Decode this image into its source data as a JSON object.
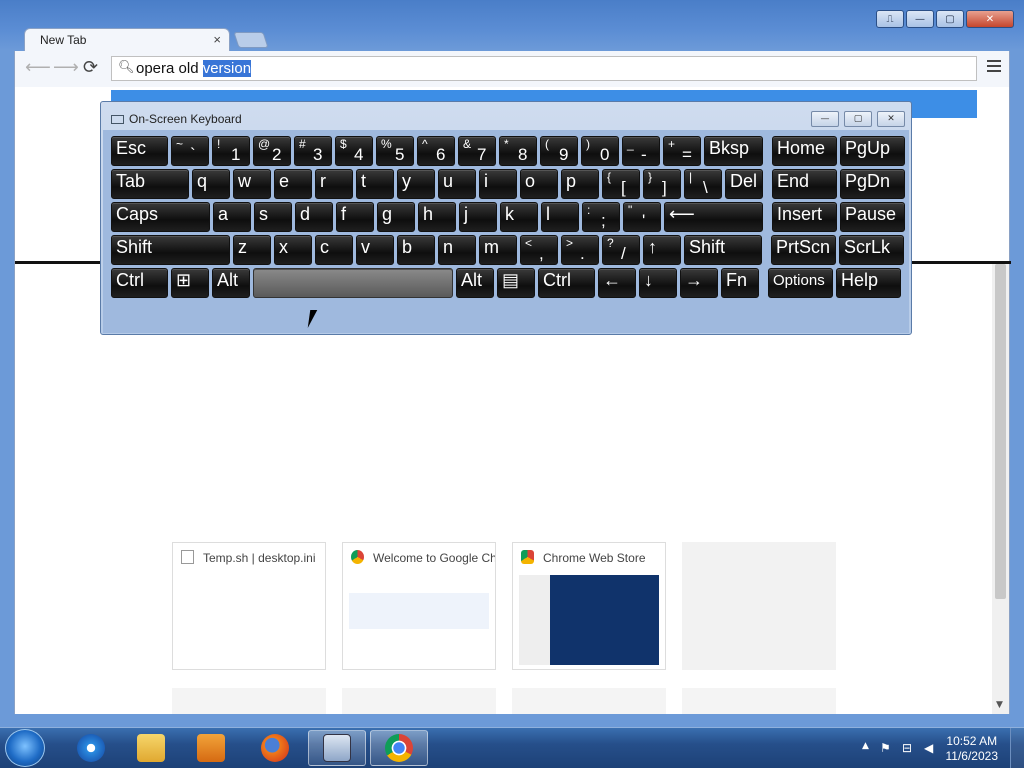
{
  "browser": {
    "tab_title": "New Tab",
    "tab_close": "×",
    "address_text": "opera old ",
    "address_selected": "version",
    "window_buttons": [
      "⎍",
      "—",
      "▢",
      "✕"
    ]
  },
  "thumbnails": [
    {
      "title": "Temp.sh | desktop.ini",
      "icon": "page-icon"
    },
    {
      "title": "Welcome to Google Chrome",
      "icon": "chrome-icon"
    },
    {
      "title": "Chrome Web Store",
      "icon": "webstore-icon"
    },
    {
      "title": "",
      "icon": ""
    }
  ],
  "osk": {
    "title": "On-Screen Keyboard",
    "row1": [
      {
        "label": "Esc"
      },
      {
        "shift": "~",
        "main": "`"
      },
      {
        "shift": "!",
        "main": "1"
      },
      {
        "shift": "@",
        "main": "2"
      },
      {
        "shift": "#",
        "main": "3"
      },
      {
        "shift": "$",
        "main": "4"
      },
      {
        "shift": "%",
        "main": "5"
      },
      {
        "shift": "^",
        "main": "6"
      },
      {
        "shift": "&",
        "main": "7"
      },
      {
        "shift": "*",
        "main": "8"
      },
      {
        "shift": "(",
        "main": "9"
      },
      {
        "shift": ")",
        "main": "0"
      },
      {
        "shift": "_",
        "main": "-"
      },
      {
        "shift": "+",
        "main": "="
      },
      {
        "label": "Bksp"
      },
      {
        "label": "Home"
      },
      {
        "label": "PgUp"
      }
    ],
    "row2": [
      {
        "label": "Tab"
      },
      {
        "label": "q"
      },
      {
        "label": "w"
      },
      {
        "label": "e"
      },
      {
        "label": "r"
      },
      {
        "label": "t"
      },
      {
        "label": "y"
      },
      {
        "label": "u"
      },
      {
        "label": "i"
      },
      {
        "label": "o"
      },
      {
        "label": "p"
      },
      {
        "shift": "{",
        "main": "["
      },
      {
        "shift": "}",
        "main": "]"
      },
      {
        "shift": "|",
        "main": "\\"
      },
      {
        "label": "Del"
      },
      {
        "label": "End"
      },
      {
        "label": "PgDn"
      }
    ],
    "row3": [
      {
        "label": "Caps"
      },
      {
        "label": "a"
      },
      {
        "label": "s"
      },
      {
        "label": "d"
      },
      {
        "label": "f"
      },
      {
        "label": "g"
      },
      {
        "label": "h"
      },
      {
        "label": "j"
      },
      {
        "label": "k"
      },
      {
        "label": "l"
      },
      {
        "shift": ":",
        "main": ";"
      },
      {
        "shift": "\"",
        "main": "'"
      },
      {
        "label": "⟵"
      },
      {
        "label": "Insert"
      },
      {
        "label": "Pause"
      }
    ],
    "row4": [
      {
        "label": "Shift"
      },
      {
        "label": "z"
      },
      {
        "label": "x"
      },
      {
        "label": "c"
      },
      {
        "label": "v"
      },
      {
        "label": "b"
      },
      {
        "label": "n"
      },
      {
        "label": "m"
      },
      {
        "shift": "<",
        "main": ","
      },
      {
        "shift": ">",
        "main": "."
      },
      {
        "shift": "?",
        "main": "/"
      },
      {
        "label": "↑"
      },
      {
        "label": "Shift"
      },
      {
        "label": "PrtScn"
      },
      {
        "label": "ScrLk"
      }
    ],
    "row5": [
      {
        "label": "Ctrl"
      },
      {
        "label": "⊞"
      },
      {
        "label": "Alt"
      },
      {
        "label": ""
      },
      {
        "label": "Alt"
      },
      {
        "label": "▤"
      },
      {
        "label": "Ctrl"
      },
      {
        "label": "←"
      },
      {
        "label": "↓"
      },
      {
        "label": "→"
      },
      {
        "label": "Fn"
      },
      {
        "label": "Options"
      },
      {
        "label": "Help"
      }
    ]
  },
  "taskbar": {
    "time": "10:52 AM",
    "date": "11/6/2023",
    "tray_expand": "▲",
    "apps": [
      "internet-explorer-icon",
      "file-explorer-icon",
      "media-player-icon",
      "firefox-icon",
      "on-screen-keyboard-icon",
      "chrome-icon"
    ]
  }
}
